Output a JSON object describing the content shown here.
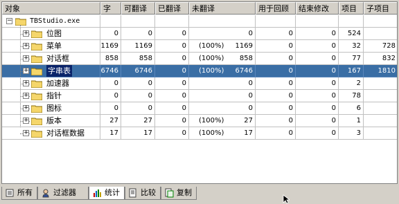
{
  "columns": [
    "对象",
    "字",
    "可翻译",
    "已翻译",
    "未翻译",
    "用于回顾",
    "结束修改",
    "项目",
    "子项目"
  ],
  "root_label": "TBStudio.exe",
  "rows": [
    {
      "name": "位图",
      "zi": "0",
      "ke": "0",
      "yi": "0",
      "wei_pct": "",
      "wei": "0",
      "review": "0",
      "finish": "0",
      "item": "524",
      "sub": ""
    },
    {
      "name": "菜单",
      "zi": "1169",
      "ke": "1169",
      "yi": "0",
      "wei_pct": "(100%)",
      "wei": "1169",
      "review": "0",
      "finish": "0",
      "item": "32",
      "sub": "728"
    },
    {
      "name": "对话框",
      "zi": "858",
      "ke": "858",
      "yi": "0",
      "wei_pct": "(100%)",
      "wei": "858",
      "review": "0",
      "finish": "0",
      "item": "77",
      "sub": "832"
    },
    {
      "name": "字串表",
      "zi": "6746",
      "ke": "6746",
      "yi": "0",
      "wei_pct": "(100%)",
      "wei": "6746",
      "review": "0",
      "finish": "0",
      "item": "167",
      "sub": "1810"
    },
    {
      "name": "加速器",
      "zi": "0",
      "ke": "0",
      "yi": "0",
      "wei_pct": "",
      "wei": "0",
      "review": "0",
      "finish": "0",
      "item": "2",
      "sub": ""
    },
    {
      "name": "指针",
      "zi": "0",
      "ke": "0",
      "yi": "0",
      "wei_pct": "",
      "wei": "0",
      "review": "0",
      "finish": "0",
      "item": "78",
      "sub": ""
    },
    {
      "name": "图标",
      "zi": "0",
      "ke": "0",
      "yi": "0",
      "wei_pct": "",
      "wei": "0",
      "review": "0",
      "finish": "0",
      "item": "6",
      "sub": ""
    },
    {
      "name": "版本",
      "zi": "27",
      "ke": "27",
      "yi": "0",
      "wei_pct": "(100%)",
      "wei": "27",
      "review": "0",
      "finish": "0",
      "item": "1",
      "sub": ""
    },
    {
      "name": "对话框数据",
      "zi": "17",
      "ke": "17",
      "yi": "0",
      "wei_pct": "(100%)",
      "wei": "17",
      "review": "0",
      "finish": "0",
      "item": "3",
      "sub": ""
    }
  ],
  "selected_row": 3,
  "tabs": [
    {
      "label": "所有",
      "icon": "list-icon"
    },
    {
      "label": "过滤器",
      "icon": "filter-icon"
    },
    {
      "label": "统计",
      "icon": "bar-chart-icon"
    },
    {
      "label": "比较",
      "icon": "compare-icon"
    },
    {
      "label": "复制",
      "icon": "copy-icon"
    }
  ],
  "active_tab": 2,
  "colors": {
    "selection": "#3a6ea5",
    "folder": "#f5d66b",
    "face": "#d4d0c8"
  }
}
